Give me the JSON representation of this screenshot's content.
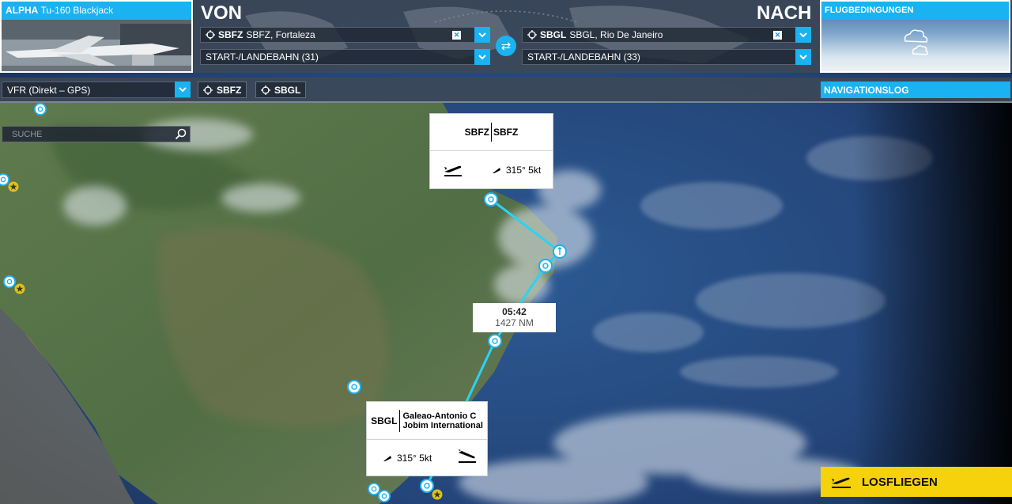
{
  "aircraft": {
    "brand": "ALPHA",
    "model": "Tu-160 Blackjack"
  },
  "header": {
    "from_title": "VON",
    "to_title": "NACH"
  },
  "departure": {
    "icao": "SBFZ",
    "name": "SBFZ, Fortaleza",
    "runway": "START-/LANDEBAHN (31)"
  },
  "arrival": {
    "icao": "SBGL",
    "name": "SBGL, Rio De Janeiro",
    "runway": "START-/LANDEBAHN (33)"
  },
  "weather": {
    "label": "FLUGBEDINGUNGEN",
    "icon": "cloud-icon"
  },
  "nav": {
    "mode": "VFR (Direkt – GPS)",
    "chip_from": "SBFZ",
    "chip_to": "SBGL",
    "log_label": "NAVIGATIONSLOG"
  },
  "search": {
    "placeholder": "SUCHE"
  },
  "popup_departure": {
    "icao_left": "SBFZ",
    "icao_right": "SBFZ",
    "wind": "315° 5kt"
  },
  "popup_arrival": {
    "icao": "SBGL",
    "name_line1": "Galeao-Antonio C",
    "name_line2": "Jobim International",
    "wind": "315° 5kt"
  },
  "route_info": {
    "time": "05:42",
    "distance": "1427 NM"
  },
  "fly_button": {
    "label": "LOSFLIEGEN"
  },
  "colors": {
    "accent": "#1ab2f0",
    "fly": "#f5d20b",
    "route": "#2ad3f4"
  }
}
